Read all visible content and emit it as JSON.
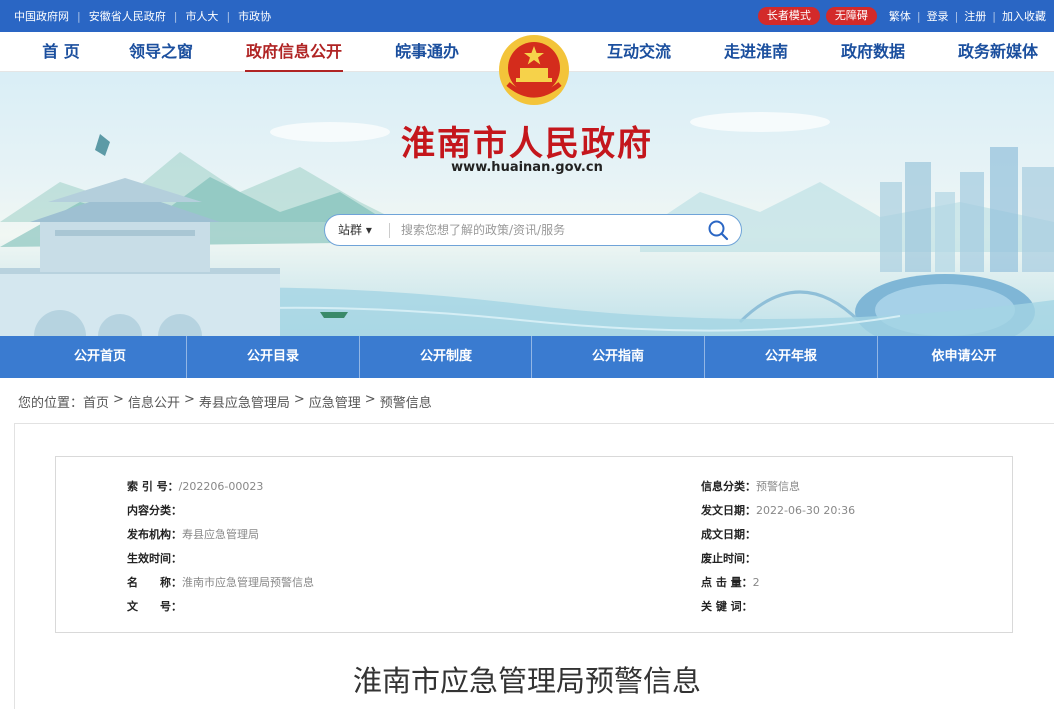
{
  "topbar": {
    "links": [
      "中国政府网",
      "安徽省人民政府",
      "市人大",
      "市政协"
    ],
    "elder_mode": "长者模式",
    "accessibility": "无障碍",
    "traditional": "繁体",
    "login": "登录",
    "register": "注册",
    "favorite": "加入收藏"
  },
  "mainnav": {
    "items": [
      "首 页",
      "领导之窗",
      "政府信息公开",
      "皖事通办",
      "互动交流",
      "走进淮南",
      "政府数据",
      "政务新媒体"
    ],
    "active": "政府信息公开"
  },
  "banner": {
    "title": "淮南市人民政府",
    "url": "www.huainan.gov.cn"
  },
  "search": {
    "scope": "站群",
    "placeholder": "搜索您想了解的政策/资讯/服务"
  },
  "subnav": {
    "items": [
      "公开首页",
      "公开目录",
      "公开制度",
      "公开指南",
      "公开年报",
      "依申请公开"
    ]
  },
  "breadcrumb": {
    "prefix": "您的位置：",
    "items": [
      "首页",
      "信息公开",
      "寿县应急管理局",
      "应急管理",
      "预警信息"
    ]
  },
  "meta": {
    "index_label": "索 引 号：",
    "index_value": "/202206-00023",
    "category_label": "信息分类：",
    "category_value": "预警信息",
    "content_label": "内容分类：",
    "content_value": "",
    "date_label": "发文日期：",
    "date_value": "2022-06-30 20:36",
    "publisher_label": "发布机构：",
    "publisher_value": "寿县应急管理局",
    "created_label": "成文日期：",
    "created_value": "",
    "effective_label": "生效时间：",
    "effective_value": "",
    "expiry_label": "废止时间：",
    "expiry_value": "",
    "name_label": "名　　称：",
    "name_value": "淮南市应急管理局预警信息",
    "clicks_label": "点 击 量：",
    "clicks_value": "2",
    "docno_label": "文　　号：",
    "docno_value": "",
    "keywords_label": "关 键 词：",
    "keywords_value": ""
  },
  "article": {
    "title": "淮南市应急管理局预警信息"
  },
  "colors": {
    "topbar": "#2a66c4",
    "subnav": "#3a7bd0",
    "title_red": "#c4161c",
    "nav_blue": "#1b4f9e"
  }
}
